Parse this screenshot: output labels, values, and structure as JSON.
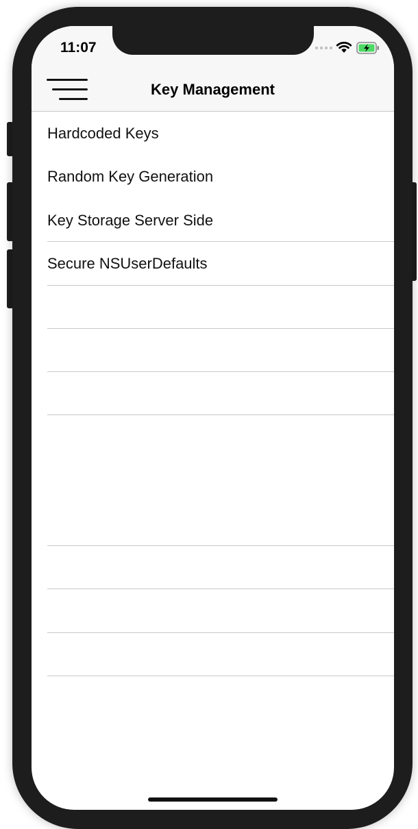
{
  "status_bar": {
    "time": "11:07",
    "wifi_icon": "wifi-icon",
    "battery_icon": "battery-charging-icon",
    "battery_color": "#4cd964"
  },
  "nav": {
    "title": "Key Management",
    "menu_icon": "hamburger-menu-icon"
  },
  "items": [
    {
      "label": "Hardcoded Keys"
    },
    {
      "label": "Random Key Generation"
    },
    {
      "label": "Key Storage Server Side"
    },
    {
      "label": "Secure NSUserDefaults"
    }
  ]
}
